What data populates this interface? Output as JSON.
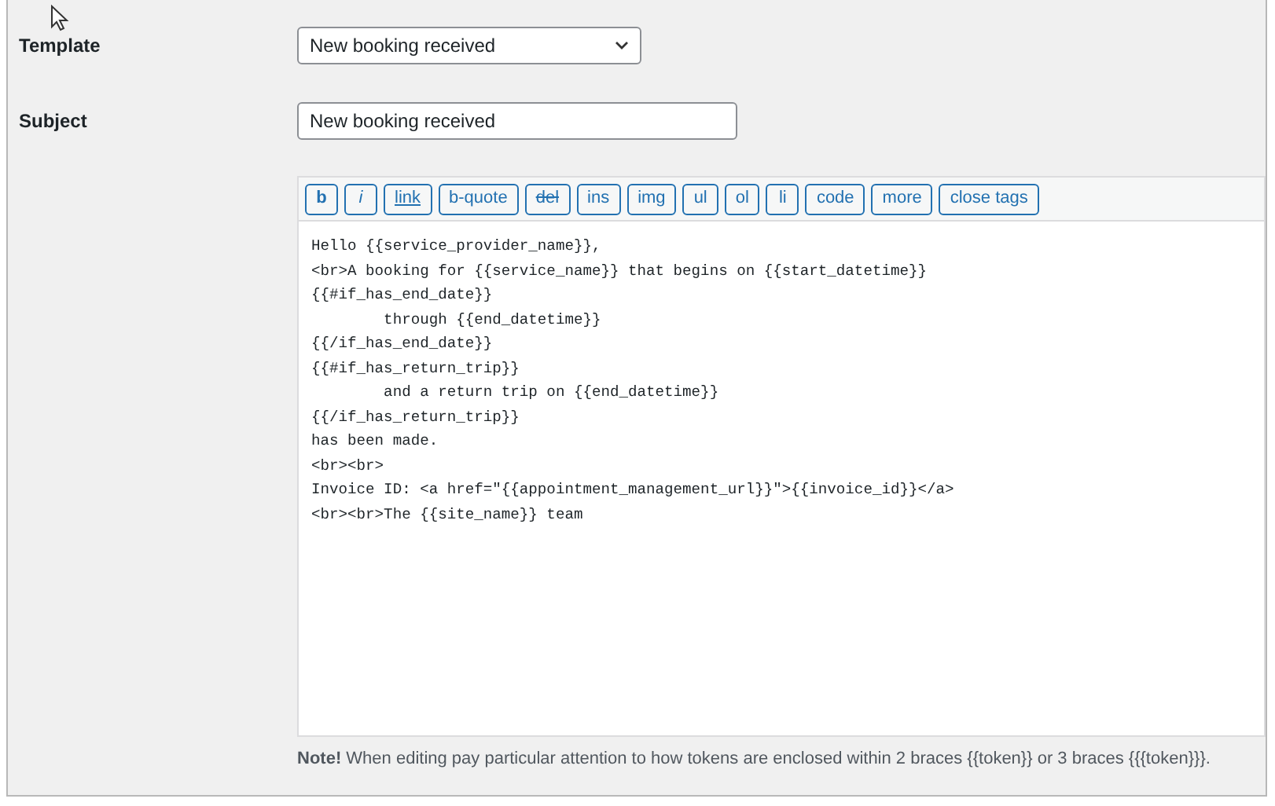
{
  "fields": [
    {
      "label": "Template",
      "kind": "select",
      "value": "New booking received"
    },
    {
      "label": "Subject",
      "kind": "text",
      "value": "New booking received"
    }
  ],
  "toolbar": [
    {
      "label": "b",
      "kind": "bold"
    },
    {
      "label": "i",
      "kind": "italic"
    },
    {
      "label": "link",
      "kind": "underline"
    },
    {
      "label": "b-quote",
      "kind": "plain"
    },
    {
      "label": "del",
      "kind": "strike"
    },
    {
      "label": "ins",
      "kind": "plain"
    },
    {
      "label": "img",
      "kind": "plain"
    },
    {
      "label": "ul",
      "kind": "plain"
    },
    {
      "label": "ol",
      "kind": "plain"
    },
    {
      "label": "li",
      "kind": "plain"
    },
    {
      "label": "code",
      "kind": "plain"
    },
    {
      "label": "more",
      "kind": "plain"
    },
    {
      "label": "close tags",
      "kind": "plain"
    }
  ],
  "body_lines": [
    "Hello {{service_provider_name}},",
    "<br>A booking for {{service_name}} that begins on {{start_datetime}}",
    "{{#if_has_end_date}}",
    "        through {{end_datetime}}",
    "{{/if_has_end_date}}",
    "{{#if_has_return_trip}}",
    "        and a return trip on {{end_datetime}}",
    "{{/if_has_return_trip}}",
    "has been made.",
    "<br><br>",
    "Invoice ID: <a href=\"{{appointment_management_url}}\">{{invoice_id}}</a>",
    "<br><br>The {{site_name}} team"
  ],
  "note": "**Note!** When editing pay particular attention to how tokens are enclosed within 2 braces {{token}} or 3 braces {{{token}}}."
}
